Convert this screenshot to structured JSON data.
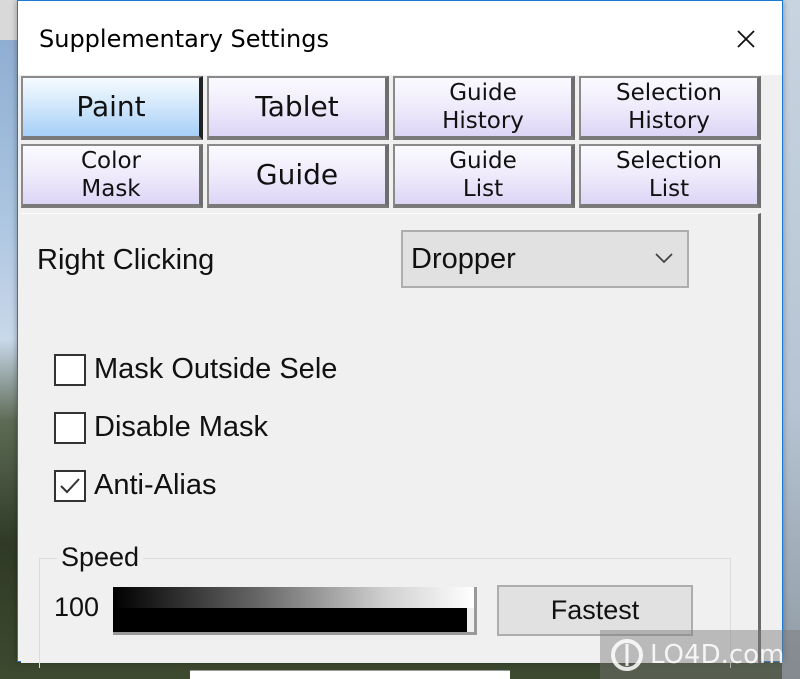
{
  "window": {
    "title": "Supplementary Settings",
    "close_icon": "close-icon"
  },
  "tabs": [
    {
      "lines": [
        "Paint"
      ],
      "active": true
    },
    {
      "lines": [
        "Tablet"
      ],
      "active": false
    },
    {
      "lines": [
        "Guide",
        "History"
      ],
      "active": false
    },
    {
      "lines": [
        "Selection",
        "History"
      ],
      "active": false
    },
    {
      "lines": [
        "Color",
        "Mask"
      ],
      "active": false
    },
    {
      "lines": [
        "Guide"
      ],
      "active": false
    },
    {
      "lines": [
        "Guide",
        "List"
      ],
      "active": false
    },
    {
      "lines": [
        "Selection",
        "List"
      ],
      "active": false
    }
  ],
  "right_clicking": {
    "label": "Right Clicking",
    "selected": "Dropper"
  },
  "checkboxes": [
    {
      "label": "Mask Outside Sele",
      "checked": false
    },
    {
      "label": "Disable Mask",
      "checked": false
    },
    {
      "label": "Anti-Alias",
      "checked": true
    }
  ],
  "speed": {
    "legend": "Speed",
    "value": "100",
    "level_percent": 100,
    "button_label": "Fastest"
  },
  "watermark": {
    "text": "LO4D.com"
  },
  "colors": {
    "accent_border": "#1a7ad4",
    "active_tab": "#a6cff7",
    "inactive_tab": "#dcd5f6"
  }
}
